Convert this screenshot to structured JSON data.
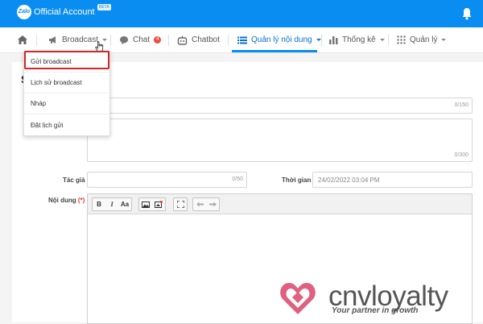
{
  "header": {
    "logo_text": "Zalo",
    "brand": "Official Account",
    "beta": "BETA",
    "icons": [
      "bell-icon"
    ]
  },
  "nav": {
    "items": [
      {
        "label": "Broadcast",
        "icon": "megaphone-icon"
      },
      {
        "label": "Chat",
        "badge": "4",
        "icon": "chat-icon"
      },
      {
        "label": "Chatbot",
        "icon": "robot-icon"
      },
      {
        "label": "Quản lý nội dung",
        "icon": "list-icon",
        "active": true
      },
      {
        "label": "Thống kê",
        "icon": "bar-chart-icon"
      },
      {
        "label": "Quản lý",
        "icon": "grid-icon"
      }
    ]
  },
  "dropdown": {
    "items": [
      "Gửi broadcast",
      "Lịch sử broadcast",
      "Nháp",
      "Đặt lịch gửi"
    ],
    "highlighted": "Gửi broadcast"
  },
  "page": {
    "title_partial": "S"
  },
  "form": {
    "title_counter": "0/150",
    "description_counter": "0/300",
    "author_label": "Tác giả",
    "author_counter": "0/50",
    "time_label": "Thời gian",
    "time_value": "24/02/2022 03:04 PM",
    "content_label": "Nội dung",
    "required_mark": "(*)"
  },
  "editor": {
    "toolbar": [
      "B",
      "I",
      "Aa",
      "image",
      "media",
      "fullscreen",
      "undo",
      "redo"
    ]
  },
  "watermark": {
    "name": "cnvloyalty",
    "tagline": "Your partner in growth"
  },
  "colors": {
    "header": "#0a8df0",
    "active_nav": "#0a6fd6",
    "highlight_border": "#d32626",
    "badge": "#f04c3e",
    "watermark_heart": "#e0607f"
  }
}
